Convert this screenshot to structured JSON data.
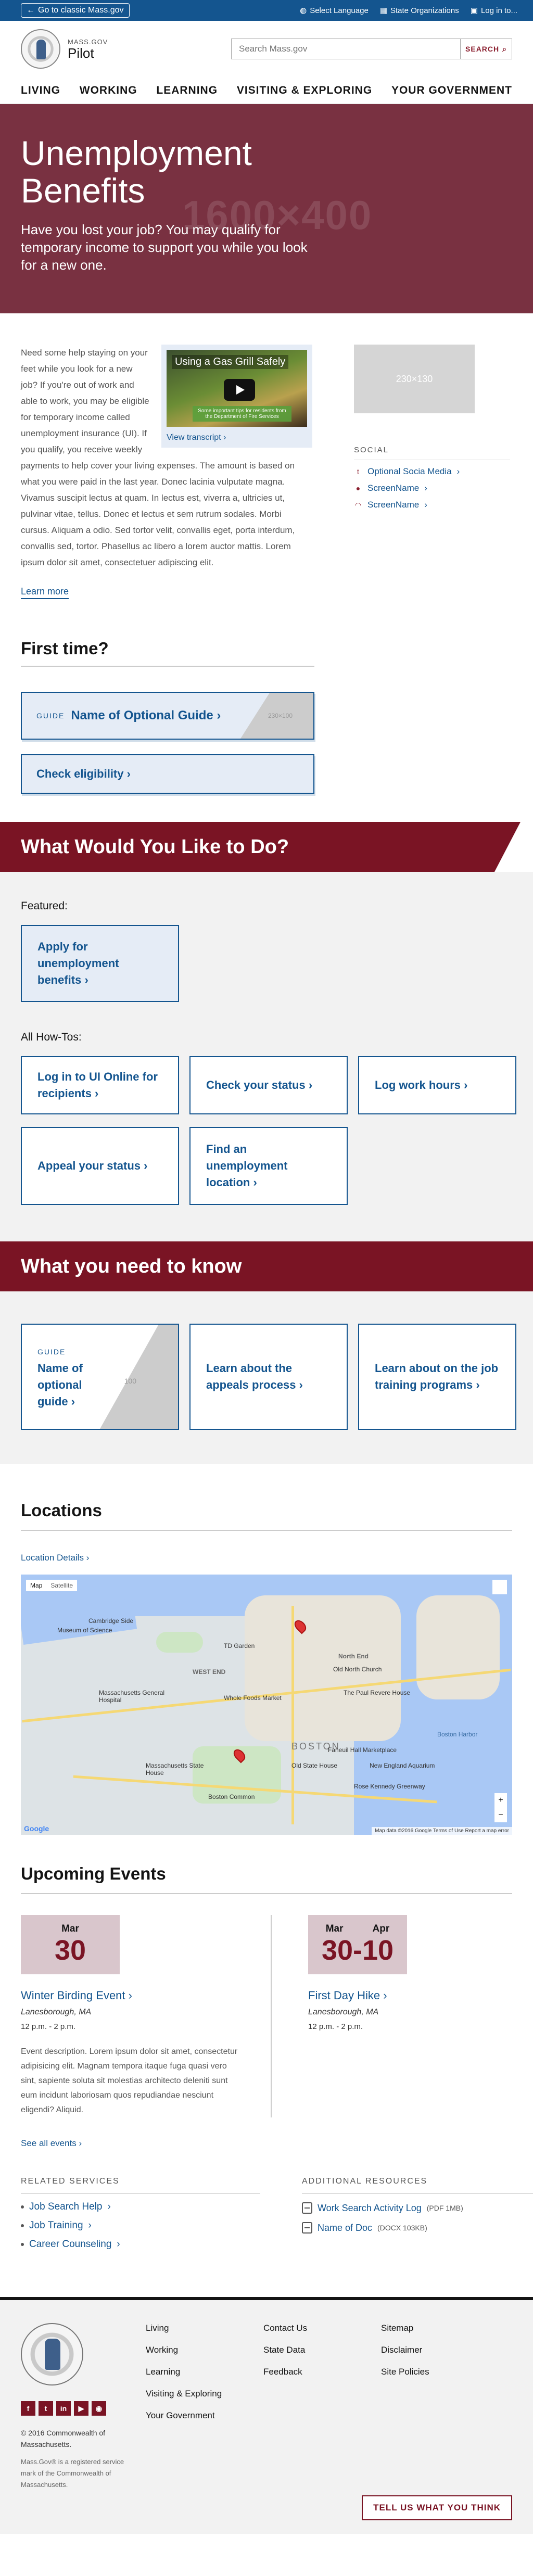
{
  "topbar": {
    "back_label": "Go to classic Mass.gov",
    "language": "Select Language",
    "state_orgs": "State Organizations",
    "login": "Log in to..."
  },
  "header": {
    "logo_small": "MASS.GOV",
    "logo_big": "Pilot",
    "search_placeholder": "Search Mass.gov",
    "search_button": "SEARCH"
  },
  "nav": [
    "Living",
    "Working",
    "Learning",
    "Visiting & Exploring",
    "Your Government"
  ],
  "hero": {
    "title": "Unemployment Benefits",
    "subtitle": "Have you lost your job? You may qualify for temporary income to support you while you look for a new one.",
    "image_placeholder": "1600×400"
  },
  "intro": {
    "text": "Need some help staying on your feet while you look for a new job? If you're out of work and able to work, you may be eligible for temporary income called unemployment insurance (UI). If you qualify, you receive weekly payments to help cover your living expenses. The amount is based on what you were paid in the last year. Donec lacinia vulputate magna. Vivamus suscipit lectus at quam. In lectus est, viverra a, ultricies ut, pulvinar vitae, tellus. Donec et lectus et sem rutrum sodales. Morbi cursus. Aliquam a odio. Sed tortor velit, convallis eget, porta interdum, convallis sed, tortor. Phasellus ac libero a lorem auctor mattis. Lorem ipsum dolor sit amet, consectetuer adipiscing elit.",
    "video_title": "Using a Gas Grill Safely",
    "video_caption": "Some important tips for residents from the Department of Fire Services",
    "video_link": "View transcript",
    "learn_more": "Learn more"
  },
  "sidebar": {
    "image_placeholder": "230×130",
    "social_title": "SOCIAL",
    "social": [
      {
        "icon": "twitter-icon",
        "glyph": "t",
        "label": "Optional Socia Media"
      },
      {
        "icon": "flickr-icon",
        "glyph": "●",
        "label": "ScreenName"
      },
      {
        "icon": "rss-icon",
        "glyph": "◠",
        "label": "ScreenName"
      }
    ]
  },
  "first_time": {
    "title": "First time?",
    "guide_tag": "GUIDE",
    "guide_name": "Name of Optional Guide",
    "guide_ph": "230×100",
    "eligibility": "Check eligibility"
  },
  "do": {
    "banner": "What Would You Like to Do?",
    "featured_label": "Featured:",
    "featured": "Apply for unemployment benefits",
    "howtos_label": "All How-Tos:",
    "howtos": [
      "Log in to UI Online for recipients",
      "Check your status",
      "Log work hours",
      "Appeal your status",
      "Find an unemployment location"
    ]
  },
  "know": {
    "banner": "What you need to know",
    "guide_tag": "GUIDE",
    "guide_name": "Name of optional guide",
    "guide_ph": "100",
    "items": [
      "Learn about the appeals process",
      "Learn about on the job training programs"
    ]
  },
  "locations": {
    "title": "Locations",
    "link": "Location Details",
    "map_tabs": [
      "Map",
      "Satellite"
    ],
    "labels": [
      "Cambridge Side",
      "Museum of Science",
      "TD Garden",
      "WEST END",
      "North End",
      "Whole Foods Market",
      "Old North Church",
      "The Paul Revere House",
      "Massachusetts General Hospital",
      "BOSTON",
      "Old State House",
      "Massachusetts State House",
      "Boston Common",
      "New England Aquarium",
      "Faneuil Hall Marketplace",
      "Rose Kennedy Greenway",
      "Boston Harbor"
    ],
    "attribution": "Map data ©2016 Google  Terms of Use  Report a map error"
  },
  "events": {
    "title": "Upcoming Events",
    "items": [
      {
        "month": "Mar",
        "day": "30",
        "title": "Winter Birding Event",
        "location": "Lanesborough, MA",
        "time": "12 p.m. - 2 p.m.",
        "desc": "Event description. Lorem ipsum dolor sit amet, consectetur adipisicing elit. Magnam tempora itaque fuga quasi vero sint, sapiente soluta sit molestias architecto deleniti sunt eum incidunt laboriosam quos repudiandae nesciunt eligendi? Aliquid."
      },
      {
        "month_start": "Mar",
        "month_end": "Apr",
        "day": "30-10",
        "title": "First Day Hike",
        "location": "Lanesborough, MA",
        "time": "12 p.m. - 2 p.m."
      }
    ],
    "see_all": "See all events"
  },
  "related": {
    "services_title": "RELATED SERVICES",
    "services": [
      "Job Search Help",
      "Job Training",
      "Career Counseling"
    ],
    "resources_title": "ADDITIONAL RESOURCES",
    "resources": [
      {
        "label": "Work Search Activity Log",
        "meta": "(PDF 1MB)"
      },
      {
        "label": "Name of Doc",
        "meta": "(DOCX 103KB)"
      }
    ]
  },
  "footer": {
    "social": [
      "f",
      "t",
      "in",
      "▶",
      "◉"
    ],
    "copyright": "© 2016 Commonwealth of Massachusetts.",
    "trademark": "Mass.Gov® is a registered service mark of the Commonwealth of Massachusetts.",
    "col1": [
      "Living",
      "Working",
      "Learning",
      "Visiting & Exploring",
      "Your Government"
    ],
    "col2": [
      "Contact Us",
      "State Data",
      "Feedback"
    ],
    "col3": [
      "Sitemap",
      "Disclaimer",
      "Site Policies"
    ],
    "feedback_button": "TELL US WHAT YOU THINK"
  },
  "colors": {
    "brand_blue": "#14558f",
    "brand_red": "#7a1424",
    "hero": "#793141"
  }
}
